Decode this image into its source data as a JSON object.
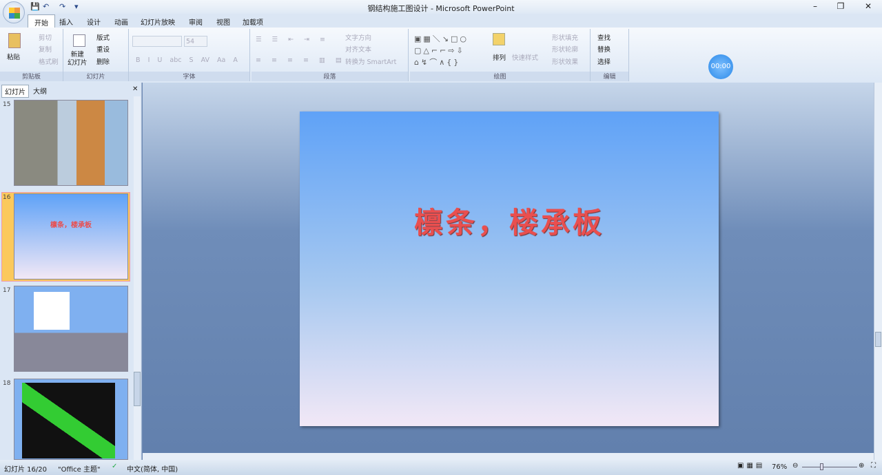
{
  "window": {
    "title": "钢结构施工图设计 - Microsoft PowerPoint",
    "min": "–",
    "restore": "❐",
    "close": "✕"
  },
  "qat": {
    "save": "💾",
    "undo": "↶",
    "redo": "↷",
    "more": "▾"
  },
  "tabs": [
    "开始",
    "插入",
    "设计",
    "动画",
    "幻灯片放映",
    "审阅",
    "视图",
    "加载项"
  ],
  "ribbon": {
    "clipboard": {
      "label": "剪贴板",
      "paste": "粘贴",
      "cut": "剪切",
      "copy": "复制",
      "format_painter": "格式刷"
    },
    "slides": {
      "label": "幻灯片",
      "new_slide": "新建\n幻灯片",
      "layout": "版式",
      "reset": "重设",
      "delete": "删除"
    },
    "font": {
      "label": "字体",
      "font_name": "",
      "font_size": "54",
      "buttons": [
        "B",
        "I",
        "U",
        "abc",
        "S",
        "AV",
        "Aa",
        "A"
      ]
    },
    "paragraph": {
      "label": "段落",
      "text_direction": "文字方向",
      "align_text": "对齐文本",
      "smartart": "转换为 SmartArt"
    },
    "drawing": {
      "label": "绘图",
      "arrange": "排列",
      "quick_styles": "快速样式",
      "shape_fill": "形状填充",
      "shape_outline": "形状轮廓",
      "shape_effects": "形状效果"
    },
    "editing": {
      "label": "编辑",
      "find": "查找",
      "replace": "替换",
      "select": "选择"
    }
  },
  "timer": "00:00",
  "pane": {
    "tab_slides": "幻灯片",
    "tab_outline": "大纲",
    "close": "✕",
    "thumbs": [
      {
        "num": "15"
      },
      {
        "num": "16",
        "title": "檩条，楼承板"
      },
      {
        "num": "17"
      },
      {
        "num": "18"
      }
    ]
  },
  "slide": {
    "title": "檩条，楼承板"
  },
  "status": {
    "slide": "幻灯片 16/20",
    "theme": "\"Office 主题\"",
    "language": "中文(简体, 中国)",
    "zoom": "76%"
  }
}
